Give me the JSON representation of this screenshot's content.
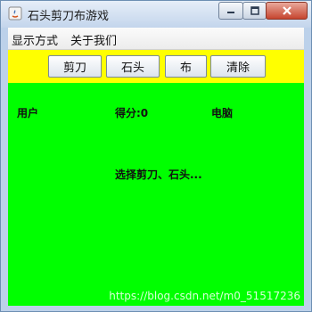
{
  "window": {
    "title": "石头剪刀布游戏",
    "icons": {
      "app": "java-app-icon",
      "minimize": "minimize-icon",
      "maximize": "maximize-icon",
      "close": "close-icon"
    }
  },
  "menu": {
    "items": [
      "显示方式",
      "关于我们"
    ]
  },
  "toolbar": {
    "buttons": [
      "剪刀",
      "石头",
      "布",
      "清除"
    ],
    "background": "#ffff00"
  },
  "content": {
    "background": "#00ff00",
    "user_label": "用户",
    "score_label": "得分:0",
    "computer_label": "电脑",
    "status_text": "选择剪刀、石头..."
  },
  "watermark": "https://blog.csdn.net/m0_51517236"
}
